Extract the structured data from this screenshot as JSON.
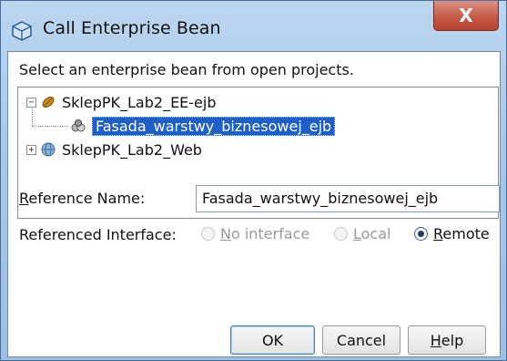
{
  "window": {
    "title": "Call Enterprise Bean",
    "close_glyph": "X"
  },
  "prompt": "Select an enterprise bean from open projects.",
  "tree": {
    "nodes": [
      {
        "label": "SklepPK_Lab2_EE-ejb",
        "expander": "−",
        "icon": "ejb-module-icon",
        "expanded": true
      },
      {
        "label": "Fasada_warstwy_biznesowej_ejb",
        "icon": "session-bean-icon",
        "selected": true
      },
      {
        "label": "SklepPK_Lab2_Web",
        "expander": "+",
        "icon": "web-globe-icon",
        "expanded": false
      }
    ]
  },
  "reference_name": {
    "label_first": "R",
    "label_rest": "eference Name:",
    "value": "Fasada_warstwy_biznesowej_ejb"
  },
  "referenced_interface": {
    "label": "Referenced Interface:",
    "options": [
      {
        "first": "N",
        "rest": "o interface",
        "enabled": false,
        "selected": false
      },
      {
        "first": "L",
        "rest": "ocal",
        "enabled": false,
        "selected": false
      },
      {
        "first": "R",
        "rest": "emote",
        "enabled": true,
        "selected": true
      }
    ]
  },
  "buttons": {
    "ok": "OK",
    "cancel": "Cancel",
    "help_first": "H",
    "help_rest": "elp"
  },
  "colors": {
    "selection": "#1f5fc9",
    "close_button": "#c65a47",
    "title_bar": "#a9c8ea"
  }
}
